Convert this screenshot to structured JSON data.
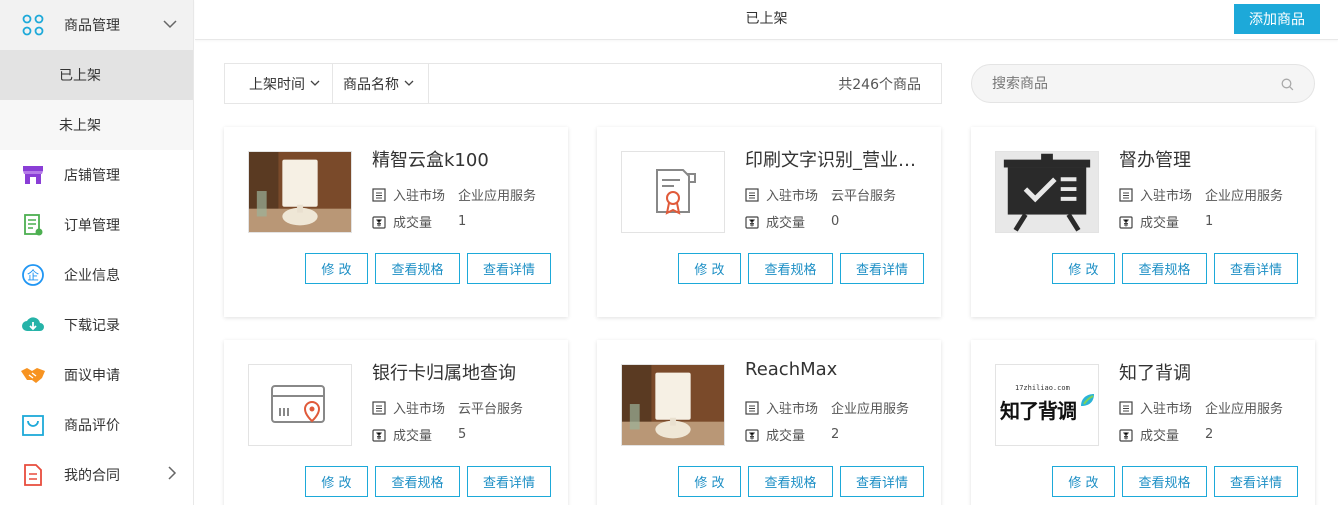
{
  "sidebar": {
    "items": [
      {
        "label": "商品管理",
        "icon": "apps-icon",
        "color": "#1da9d9"
      },
      {
        "label": "店铺管理",
        "icon": "store-icon",
        "color": "#8a3ed6"
      },
      {
        "label": "订单管理",
        "icon": "order-icon",
        "color": "#4caf50"
      },
      {
        "label": "企业信息",
        "icon": "enterprise-icon",
        "color": "#2196f3"
      },
      {
        "label": "下载记录",
        "icon": "cloud-download-icon",
        "color": "#26b3a8"
      },
      {
        "label": "面议申请",
        "icon": "handshake-icon",
        "color": "#f79321"
      },
      {
        "label": "商品评价",
        "icon": "bag-icon",
        "color": "#1da9d9"
      },
      {
        "label": "我的合同",
        "icon": "contract-icon",
        "color": "#e84c3d"
      }
    ],
    "sub_items": [
      {
        "label": "已上架"
      },
      {
        "label": "未上架"
      }
    ]
  },
  "header": {
    "title": "已上架",
    "add_button": "添加商品"
  },
  "filters": {
    "time": "上架时间",
    "name": "商品名称",
    "count_text": "共246个商品"
  },
  "search": {
    "placeholder": "搜索商品"
  },
  "card_labels": {
    "market": "入驻市场",
    "volume": "成交量",
    "edit": "修 改",
    "spec": "查看规格",
    "detail": "查看详情"
  },
  "products": [
    {
      "name": "精智云盒k100",
      "market": "企业应用服务",
      "volume": "1",
      "thumb": "lamp-image"
    },
    {
      "name": "印刷文字识别_营业执照识别",
      "market": "云平台服务",
      "volume": "0",
      "thumb": "certificate-image"
    },
    {
      "name": "督办管理",
      "market": "企业应用服务",
      "volume": "1",
      "thumb": "presentation-board-image"
    },
    {
      "name": "银行卡归属地查询",
      "market": "云平台服务",
      "volume": "5",
      "thumb": "bank-card-image"
    },
    {
      "name": "ReachMax",
      "market": "企业应用服务",
      "volume": "2",
      "thumb": "lamp-image"
    },
    {
      "name": "知了背调",
      "market": "企业应用服务",
      "volume": "2",
      "thumb": "zhiliao-logo",
      "logo_domain": "17zhiliao.com",
      "logo_text": "知了背调"
    }
  ],
  "colors": {
    "accent": "#1da9d9",
    "active_sub_bg": "#e3e3e3"
  }
}
